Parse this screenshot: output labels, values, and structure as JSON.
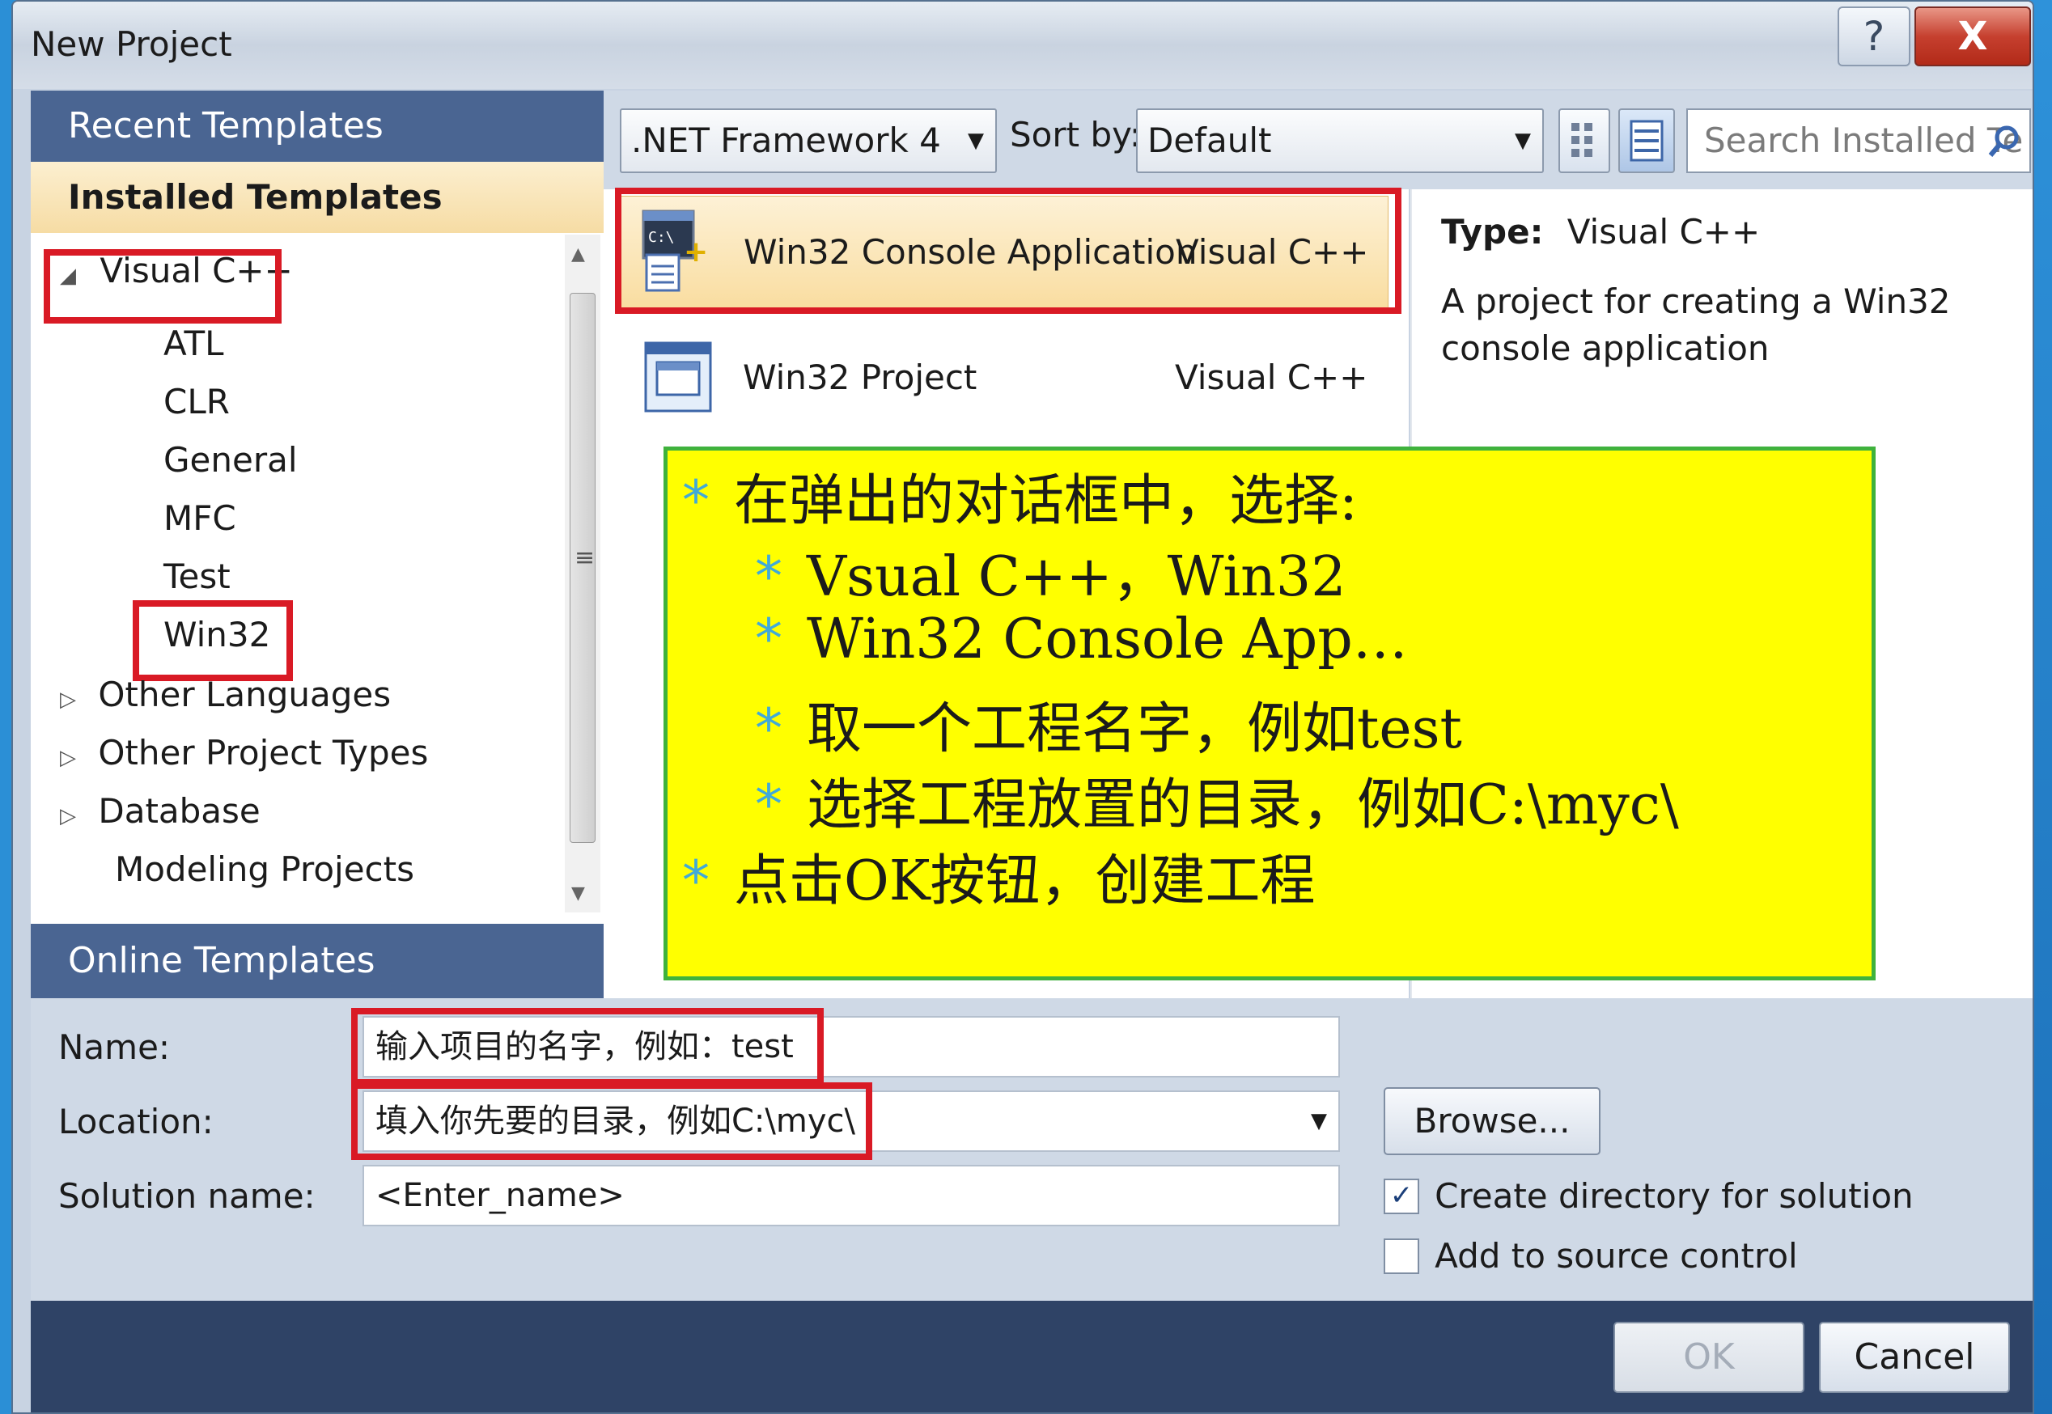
{
  "window": {
    "title": "New Project",
    "help_glyph": "?",
    "close_glyph": "X"
  },
  "left": {
    "recent_templates": "Recent Templates",
    "installed_templates": "Installed Templates",
    "online_templates": "Online Templates",
    "tree": {
      "visual_cpp": "Visual C++",
      "atl": "ATL",
      "clr": "CLR",
      "general": "General",
      "mfc": "MFC",
      "test": "Test",
      "win32": "Win32",
      "other_languages": "Other Languages",
      "other_project_types": "Other Project Types",
      "database": "Database",
      "modeling_projects": "Modeling Projects"
    }
  },
  "toolbar": {
    "framework": ".NET Framework 4",
    "sort_by_label": "Sort by:",
    "sort_value": "Default",
    "search_placeholder": "Search Installed Te"
  },
  "templates": [
    {
      "name": "Win32 Console Application",
      "lang": "Visual C++",
      "icon": "console-app-icon",
      "selected": true
    },
    {
      "name": "Win32 Project",
      "lang": "Visual C++",
      "icon": "win32-project-icon",
      "selected": false
    }
  ],
  "details": {
    "type_label": "Type:",
    "type_value": "Visual C++",
    "description": "A project for creating a Win32 console application"
  },
  "annotation": {
    "lines": [
      "在弹出的对话框中，选择:",
      "Vsual C++，Win32",
      "Win32 Console App…",
      "取一个工程名字，例如test",
      "选择工程放置的目录，例如C:\\myc\\",
      "点击OK按钮，创建工程"
    ],
    "bullet": "*"
  },
  "form": {
    "name_label": "Name:",
    "name_value": "输入项目的名字，例如：test",
    "location_label": "Location:",
    "location_value": "填入你先要的目录，例如C:\\myc\\",
    "solution_label": "Solution name:",
    "solution_value": "<Enter_name>",
    "browse": "Browse...",
    "create_dir": "Create directory for solution",
    "create_dir_checked": true,
    "add_source": "Add to source control",
    "add_source_checked": false
  },
  "buttons": {
    "ok": "OK",
    "cancel": "Cancel"
  },
  "colors": {
    "highlight_red": "#d91a25",
    "annotation_yellow": "#ffff00",
    "annotation_border": "#3fb23c",
    "header_blue": "#4a6592",
    "selected_orange": "#f9dda0"
  }
}
